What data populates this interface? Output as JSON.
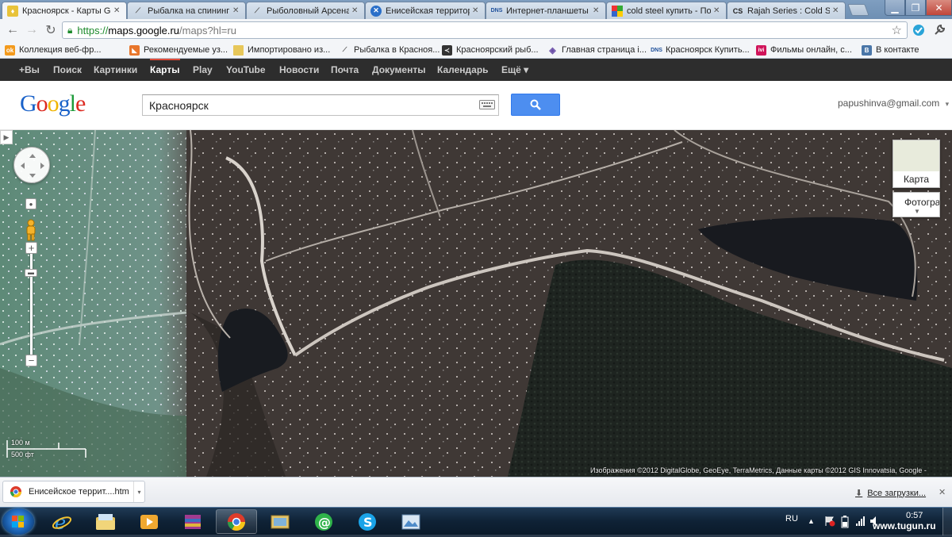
{
  "browser": {
    "tabs": [
      {
        "title": "Красноярск - Карты Go",
        "icon": "google-maps-icon",
        "active": true
      },
      {
        "title": "Рыбалка на спининг -",
        "icon": "fishing-rod-icon",
        "active": false
      },
      {
        "title": "Рыболовный Арсенал",
        "icon": "fishing-rod-icon",
        "active": false
      },
      {
        "title": "Енисейская территор",
        "icon": "site-logo-icon",
        "active": false
      },
      {
        "title": "Интернет-планшеты |",
        "icon": "dns-logo-icon",
        "active": false
      },
      {
        "title": "cold steel купить - Пои",
        "icon": "google-icon",
        "active": false
      },
      {
        "title": "Rajah Series : Cold Stee",
        "icon": "cold-steel-icon",
        "active": false
      }
    ],
    "address": {
      "scheme": "https://",
      "host": "maps.google.ru",
      "path": "/maps?hl=ru"
    },
    "bookmarks": [
      {
        "label": "Коллекция веб-фр...",
        "icon": "odnoklassniki-icon"
      },
      {
        "label": "Рекомендуемые уз...",
        "icon": "slice-icon"
      },
      {
        "label": "Импортировано из...",
        "icon": "folder-icon"
      },
      {
        "label": "Рыбалка в Красноя...",
        "icon": "fishing-rod-icon"
      },
      {
        "label": "Красноярский рыб...",
        "icon": "fish-icon"
      },
      {
        "label": "Главная страница i...",
        "icon": "globe-icon"
      },
      {
        "label": "Красноярск Купить...",
        "icon": "dns-logo-icon"
      },
      {
        "label": "Фильмы онлайн, с...",
        "icon": "ivi-logo-icon"
      },
      {
        "label": "В контакте",
        "icon": "vk-icon"
      }
    ]
  },
  "google_bar": {
    "items": [
      "+Вы",
      "Поиск",
      "Картинки",
      "Карты",
      "Play",
      "YouTube",
      "Новости",
      "Почта",
      "Документы",
      "Календарь",
      "Ещё ▾"
    ],
    "active": "Карты"
  },
  "header": {
    "logo": "Google",
    "search_value": "Красноярск",
    "account": "papushinva@gmail.com"
  },
  "map": {
    "map_type_label": "Карта",
    "satellite_label": "Фотограф",
    "scale_metric": "100 м",
    "scale_imperial": "500 фт",
    "attribution": "Изображения ©2012 DigitalGlobe, GeoEye, TerraMetrics, Данные карты ©2012 GIS Innovatsia, Google -"
  },
  "downloads": {
    "item": "Енисейское террит....htm",
    "show_all": "Все загрузки..."
  },
  "taskbar": {
    "language": "RU",
    "clock": "0:57",
    "watermark": "www.tugun.ru"
  }
}
